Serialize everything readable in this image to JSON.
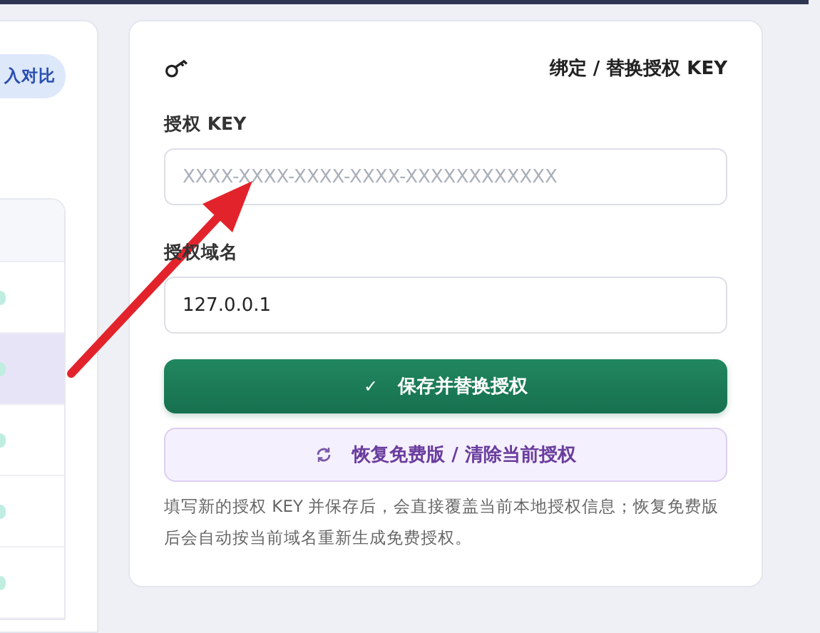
{
  "left_panel": {
    "compare_button": "入对比",
    "table": {
      "rows": [
        {
          "selected": false
        },
        {
          "selected": true
        },
        {
          "selected": false
        },
        {
          "selected": false
        },
        {
          "selected": false
        }
      ]
    }
  },
  "license_card": {
    "title": "绑定 / 替换授权 KEY",
    "fields": [
      {
        "label": "授权 KEY",
        "placeholder": "XXXX-XXXX-XXXX-XXXX-XXXXXXXXXXXX"
      },
      {
        "label": "授权域名",
        "value": "127.0.0.1"
      }
    ],
    "buttons": [
      {
        "kind": "primary",
        "icon": "✓",
        "label": "保存并替换授权"
      },
      {
        "kind": "secondary",
        "label": "恢复免费版 / 清除当前授权"
      }
    ],
    "note": "填写新的授权 KEY 并保存后，会直接覆盖当前本地授权信息；恢复免费版后会自动按当前域名重新生成免费授权。"
  }
}
